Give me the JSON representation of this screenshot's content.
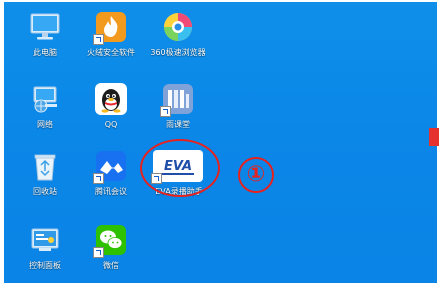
{
  "desktop": {
    "icons": [
      {
        "id": "this-pc",
        "label": "此电脑"
      },
      {
        "id": "huorong",
        "label": "火绒安全软件"
      },
      {
        "id": "browser-360",
        "label": "360极速浏览器"
      },
      {
        "id": "network",
        "label": "网络"
      },
      {
        "id": "qq",
        "label": "QQ"
      },
      {
        "id": "yuketang",
        "label": "雨课堂"
      },
      {
        "id": "recycle-bin",
        "label": "回收站"
      },
      {
        "id": "tencent-meeting",
        "label": "腾讯会议"
      },
      {
        "id": "eva-recorder",
        "label": "EVA录播助手"
      },
      {
        "id": "control-panel",
        "label": "控制面板"
      },
      {
        "id": "wechat",
        "label": "微信"
      }
    ]
  },
  "eva_logo_text": "EVA",
  "annotation": {
    "step": "①"
  },
  "colors": {
    "desktop": "#0b87e8",
    "annotation": "#e5221f"
  }
}
